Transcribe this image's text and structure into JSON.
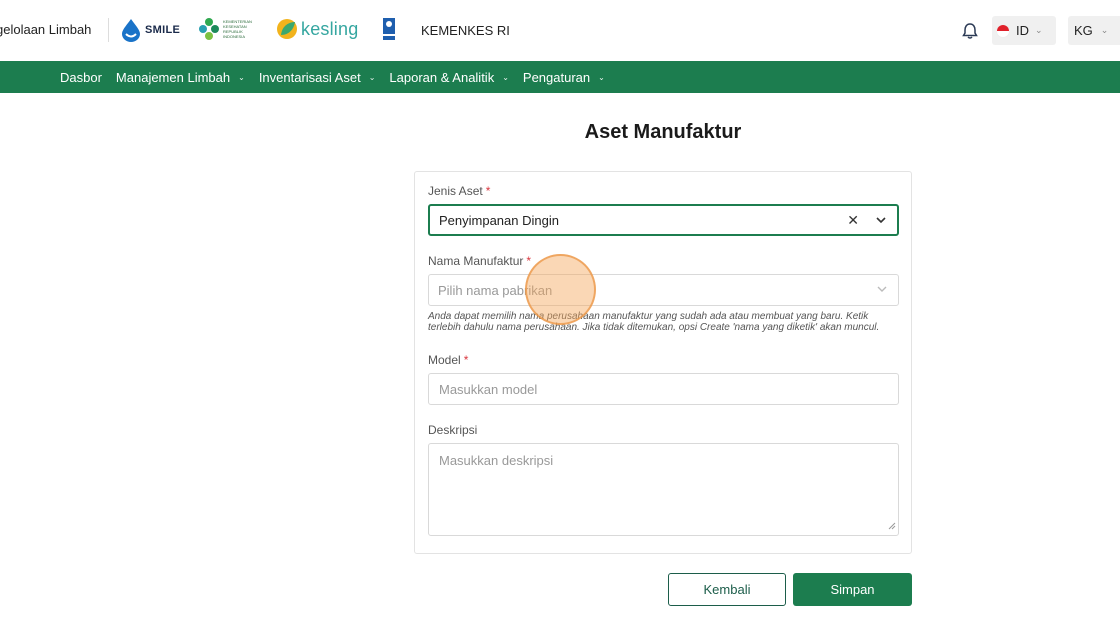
{
  "header": {
    "app_title": "gelolaan Limbah",
    "logos": {
      "smile": "SMILE",
      "kemkes_small": "KEMENTERIAN KESEHATAN REPUBLIK INDONESIA",
      "kesling": "kesling"
    },
    "org": "KEMENKES RI",
    "language": {
      "code": "ID"
    },
    "user": {
      "initials": "KG"
    }
  },
  "nav": {
    "items": [
      {
        "label": "Dasbor",
        "has_dropdown": false
      },
      {
        "label": "Manajemen Limbah",
        "has_dropdown": true
      },
      {
        "label": "Inventarisasi Aset",
        "has_dropdown": true
      },
      {
        "label": "Laporan & Analitik",
        "has_dropdown": true
      },
      {
        "label": "Pengaturan",
        "has_dropdown": true
      }
    ]
  },
  "page": {
    "title": "Aset Manufaktur"
  },
  "form": {
    "asset_type": {
      "label": "Jenis Aset",
      "required": "*",
      "value": "Penyimpanan Dingin"
    },
    "manufacturer": {
      "label": "Nama Manufaktur",
      "required": "*",
      "placeholder": "Pilih nama pabrikan",
      "hint": "Anda dapat memilih nama perusahaan manufaktur yang sudah ada atau membuat yang baru. Ketik terlebih dahulu nama perusahaan. Jika tidak ditemukan, opsi Create 'nama yang diketik' akan muncul."
    },
    "model": {
      "label": "Model",
      "required": "*",
      "placeholder": "Masukkan model"
    },
    "description": {
      "label": "Deskripsi",
      "placeholder": "Masukkan deskripsi"
    }
  },
  "actions": {
    "back_label": "Kembali",
    "save_label": "Simpan"
  },
  "colors": {
    "primary": "#1c7d4f",
    "required": "#d9363e"
  }
}
